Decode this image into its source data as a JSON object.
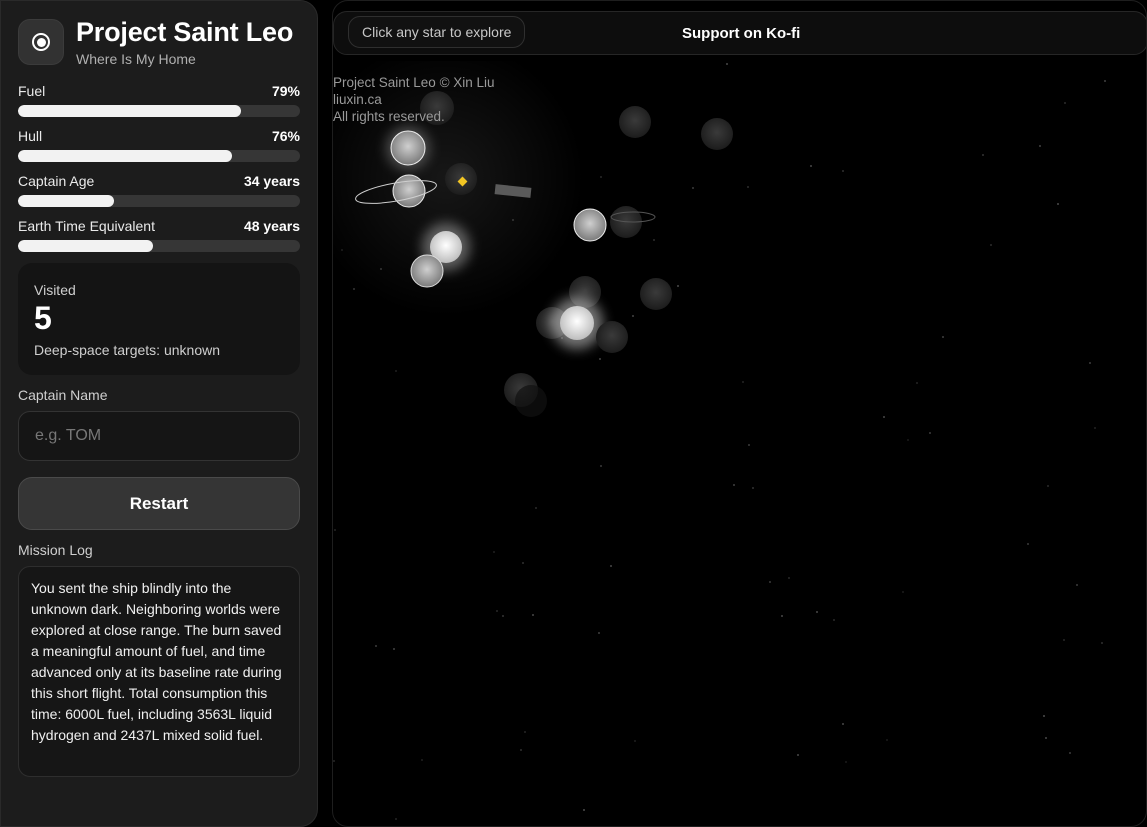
{
  "brand": {
    "title": "Project Saint Leo",
    "subtitle": "Where Is My Home",
    "icon": "target-ring-icon"
  },
  "meters": [
    {
      "label": "Fuel",
      "value": "79%",
      "percent": 79
    },
    {
      "label": "Hull",
      "value": "76%",
      "percent": 76
    },
    {
      "label": "Captain Age",
      "value": "34 years",
      "percent": 34
    },
    {
      "label": "Earth Time Equivalent",
      "value": "48 years",
      "percent": 48
    }
  ],
  "visited": {
    "label": "Visited",
    "count": "5",
    "note": "Deep-space targets: unknown"
  },
  "captain": {
    "label": "Captain Name",
    "placeholder": "e.g. TOM"
  },
  "restart_label": "Restart",
  "log": {
    "label": "Mission Log",
    "text": "You sent the ship blindly into the unknown dark. Neighboring worlds were explored at close range. The burn saved a meaningful amount of fuel, and time advanced only at its baseline rate during this short flight. Total consumption this time: 6000L fuel, including 3563L liquid hydrogen and 2437L mixed solid fuel."
  },
  "topbar": {
    "hint": "Click any star to explore",
    "kofi": "Support on Ko-fi"
  },
  "credit": {
    "line1": "Project Saint Leo © Xin Liu",
    "line2": "liuxin.ca",
    "line3": "All rights reserved."
  },
  "colors": {
    "ship_marker": "#f3c623",
    "sidebar_bg": "#1c1c1c",
    "space_bg": "#000000"
  }
}
